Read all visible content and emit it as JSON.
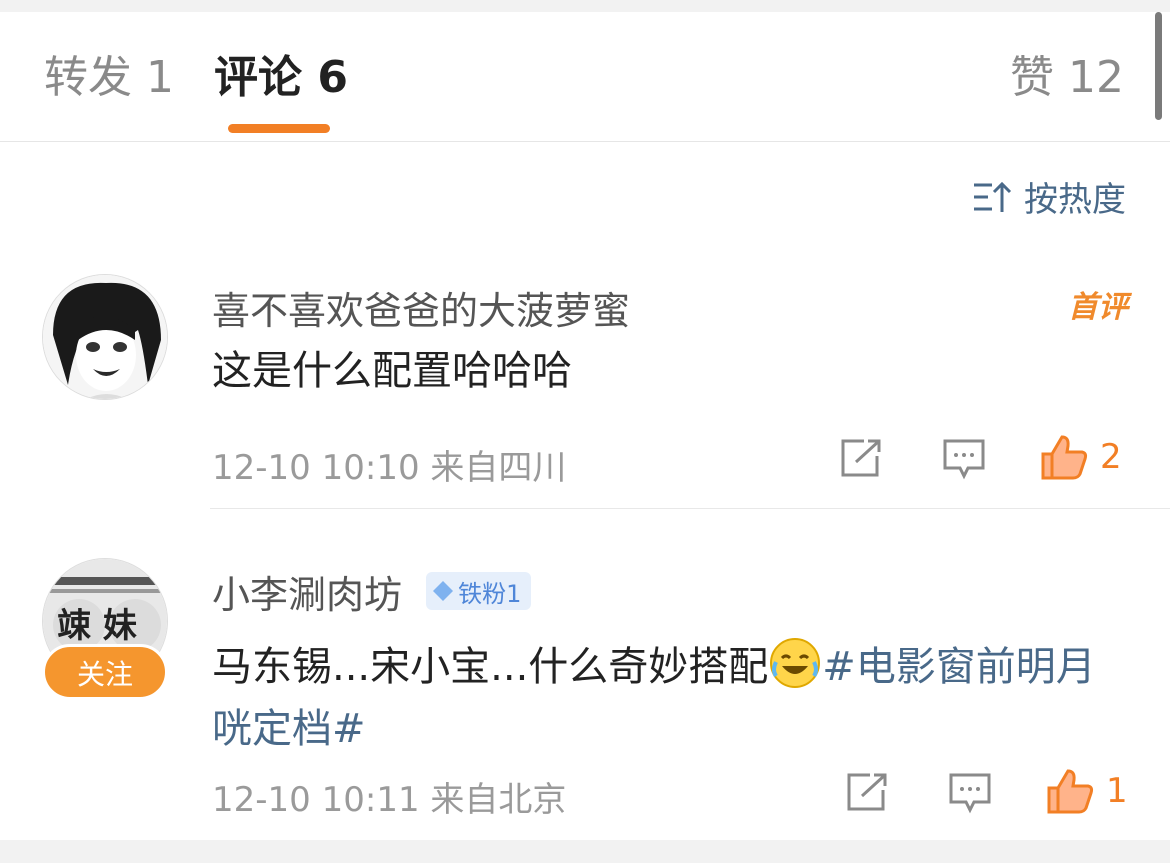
{
  "tabs": [
    {
      "label": "转发 1"
    },
    {
      "label": "评论 6"
    },
    {
      "label": "赞 12"
    }
  ],
  "sort": {
    "label": "按热度",
    "icon": "sort-icon"
  },
  "comments": [
    {
      "username": "喜不喜欢爸爸的大菠萝蜜",
      "text": "这是什么配置哈哈哈",
      "timestamp": "12-10 10:10",
      "location": "来自四川",
      "likes": "2",
      "badge": "首评"
    },
    {
      "username": "小李涮肉坊",
      "fan_badge": "铁粉1",
      "text": "马东锡...宋小宝...什么奇妙搭配",
      "hashtag": "#电影窗前明月咣定档#",
      "timestamp": "12-10 10:11",
      "location": "来自北京",
      "likes": "1",
      "follow_label": "关注",
      "avatar_text": "竦 妹"
    }
  ],
  "colors": {
    "accent": "#f27f25",
    "link": "#496989",
    "meta": "#9a9a9a"
  }
}
